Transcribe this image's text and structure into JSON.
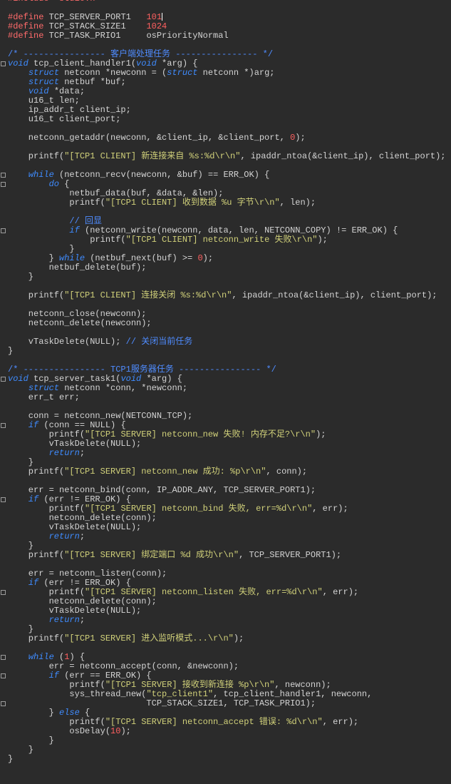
{
  "editor": {
    "language": "C",
    "theme": {
      "background": "#2b2b2b",
      "text": "#d4d4d4",
      "keyword": "#3f8cff",
      "preprocessor": "#ff6b6b",
      "string": "#d1d17a",
      "comment": "#4f8cff",
      "number": "#ff6060"
    },
    "lines": [
      [
        [
          "pp",
          "#include <stdio.h>"
        ]
      ],
      [],
      [
        [
          "pp",
          "#define"
        ],
        [
          "t",
          " TCP_SERVER_PORT1   "
        ],
        [
          "num",
          "101"
        ],
        [
          "caret",
          ""
        ]
      ],
      [
        [
          "pp",
          "#define"
        ],
        [
          "t",
          " TCP_STACK_SIZE1    "
        ],
        [
          "num",
          "1024"
        ]
      ],
      [
        [
          "pp",
          "#define"
        ],
        [
          "t",
          " TCP_TASK_PRIO1     osPriorityNormal"
        ]
      ],
      [],
      [
        [
          "cm",
          "/* ---------------- 客户端处理任务 ---------------- */"
        ]
      ],
      [
        [
          "kw",
          "void"
        ],
        [
          "t",
          " tcp_client_handler1("
        ],
        [
          "kw",
          "void"
        ],
        [
          "t",
          " *arg) {"
        ]
      ],
      [
        [
          "t",
          "    "
        ],
        [
          "kw",
          "struct"
        ],
        [
          "t",
          " netconn *newconn = ("
        ],
        [
          "kw",
          "struct"
        ],
        [
          "t",
          " netconn *)arg;"
        ]
      ],
      [
        [
          "t",
          "    "
        ],
        [
          "kw",
          "struct"
        ],
        [
          "t",
          " netbuf *buf;"
        ]
      ],
      [
        [
          "t",
          "    "
        ],
        [
          "kw",
          "void"
        ],
        [
          "t",
          " *data;"
        ]
      ],
      [
        [
          "t",
          "    u16_t len;"
        ]
      ],
      [
        [
          "t",
          "    ip_addr_t client_ip;"
        ]
      ],
      [
        [
          "t",
          "    u16_t client_port;"
        ]
      ],
      [],
      [
        [
          "t",
          "    netconn_getaddr(newconn, &client_ip, &client_port, "
        ],
        [
          "num",
          "0"
        ],
        [
          "t",
          ");"
        ]
      ],
      [],
      [
        [
          "t",
          "    printf("
        ],
        [
          "str",
          "\"[TCP1 CLIENT] 新连接来自 %s:%d\\r\\n\""
        ],
        [
          "t",
          ", ipaddr_ntoa(&client_ip), client_port);"
        ]
      ],
      [],
      [
        [
          "t",
          "    "
        ],
        [
          "kw",
          "while"
        ],
        [
          "t",
          " (netconn_recv(newconn, &buf) == ERR_OK) {"
        ]
      ],
      [
        [
          "t",
          "        "
        ],
        [
          "kw",
          "do"
        ],
        [
          "t",
          " {"
        ]
      ],
      [
        [
          "t",
          "            netbuf_data(buf, &data, &len);"
        ]
      ],
      [
        [
          "t",
          "            printf("
        ],
        [
          "str",
          "\"[TCP1 CLIENT] 收到数据 %u 字节\\r\\n\""
        ],
        [
          "t",
          ", len);"
        ]
      ],
      [],
      [
        [
          "t",
          "            "
        ],
        [
          "cm",
          "// 回显"
        ]
      ],
      [
        [
          "t",
          "            "
        ],
        [
          "kw",
          "if"
        ],
        [
          "t",
          " (netconn_write(newconn, data, len, NETCONN_COPY) != ERR_OK) {"
        ]
      ],
      [
        [
          "t",
          "                printf("
        ],
        [
          "str",
          "\"[TCP1 CLIENT] netconn_write 失败\\r\\n\""
        ],
        [
          "t",
          ");"
        ]
      ],
      [
        [
          "t",
          "            }"
        ]
      ],
      [
        [
          "t",
          "        } "
        ],
        [
          "kw",
          "while"
        ],
        [
          "t",
          " (netbuf_next(buf) >= "
        ],
        [
          "num",
          "0"
        ],
        [
          "t",
          ");"
        ]
      ],
      [
        [
          "t",
          "        netbuf_delete(buf);"
        ]
      ],
      [
        [
          "t",
          "    }"
        ]
      ],
      [],
      [
        [
          "t",
          "    printf("
        ],
        [
          "str",
          "\"[TCP1 CLIENT] 连接关闭 %s:%d\\r\\n\""
        ],
        [
          "t",
          ", ipaddr_ntoa(&client_ip), client_port);"
        ]
      ],
      [],
      [
        [
          "t",
          "    netconn_close(newconn);"
        ]
      ],
      [
        [
          "t",
          "    netconn_delete(newconn);"
        ]
      ],
      [],
      [
        [
          "t",
          "    vTaskDelete(NULL); "
        ],
        [
          "cm",
          "// 关闭当前任务"
        ]
      ],
      [
        [
          "t",
          "}"
        ]
      ],
      [],
      [
        [
          "cm",
          "/* ---------------- TCP1服务器任务 ---------------- */"
        ]
      ],
      [
        [
          "kw",
          "void"
        ],
        [
          "t",
          " tcp_server_task1("
        ],
        [
          "kw",
          "void"
        ],
        [
          "t",
          " *arg) {"
        ]
      ],
      [
        [
          "t",
          "    "
        ],
        [
          "kw",
          "struct"
        ],
        [
          "t",
          " netconn *conn, *newconn;"
        ]
      ],
      [
        [
          "t",
          "    err_t err;"
        ]
      ],
      [],
      [
        [
          "t",
          "    conn = netconn_new(NETCONN_TCP);"
        ]
      ],
      [
        [
          "t",
          "    "
        ],
        [
          "kw",
          "if"
        ],
        [
          "t",
          " (conn == NULL) {"
        ]
      ],
      [
        [
          "t",
          "        printf("
        ],
        [
          "str",
          "\"[TCP1 SERVER] netconn_new 失败! 内存不足?\\r\\n\""
        ],
        [
          "t",
          ");"
        ]
      ],
      [
        [
          "t",
          "        vTaskDelete(NULL);"
        ]
      ],
      [
        [
          "t",
          "        "
        ],
        [
          "kw",
          "return"
        ],
        [
          "t",
          ";"
        ]
      ],
      [
        [
          "t",
          "    }"
        ]
      ],
      [
        [
          "t",
          "    printf("
        ],
        [
          "str",
          "\"[TCP1 SERVER] netconn_new 成功: %p\\r\\n\""
        ],
        [
          "t",
          ", conn);"
        ]
      ],
      [],
      [
        [
          "t",
          "    err = netconn_bind(conn, IP_ADDR_ANY, TCP_SERVER_PORT1);"
        ]
      ],
      [
        [
          "t",
          "    "
        ],
        [
          "kw",
          "if"
        ],
        [
          "t",
          " (err != ERR_OK) {"
        ]
      ],
      [
        [
          "t",
          "        printf("
        ],
        [
          "str",
          "\"[TCP1 SERVER] netconn_bind 失败, err=%d\\r\\n\""
        ],
        [
          "t",
          ", err);"
        ]
      ],
      [
        [
          "t",
          "        netconn_delete(conn);"
        ]
      ],
      [
        [
          "t",
          "        vTaskDelete(NULL);"
        ]
      ],
      [
        [
          "t",
          "        "
        ],
        [
          "kw",
          "return"
        ],
        [
          "t",
          ";"
        ]
      ],
      [
        [
          "t",
          "    }"
        ]
      ],
      [
        [
          "t",
          "    printf("
        ],
        [
          "str",
          "\"[TCP1 SERVER] 绑定端口 %d 成功\\r\\n\""
        ],
        [
          "t",
          ", TCP_SERVER_PORT1);"
        ]
      ],
      [],
      [
        [
          "t",
          "    err = netconn_listen(conn);"
        ]
      ],
      [
        [
          "t",
          "    "
        ],
        [
          "kw",
          "if"
        ],
        [
          "t",
          " (err != ERR_OK) {"
        ]
      ],
      [
        [
          "t",
          "        printf("
        ],
        [
          "str",
          "\"[TCP1 SERVER] netconn_listen 失败, err=%d\\r\\n\""
        ],
        [
          "t",
          ", err);"
        ]
      ],
      [
        [
          "t",
          "        netconn_delete(conn);"
        ]
      ],
      [
        [
          "t",
          "        vTaskDelete(NULL);"
        ]
      ],
      [
        [
          "t",
          "        "
        ],
        [
          "kw",
          "return"
        ],
        [
          "t",
          ";"
        ]
      ],
      [
        [
          "t",
          "    }"
        ]
      ],
      [
        [
          "t",
          "    printf("
        ],
        [
          "str",
          "\"[TCP1 SERVER] 进入监听模式...\\r\\n\""
        ],
        [
          "t",
          ");"
        ]
      ],
      [],
      [
        [
          "t",
          "    "
        ],
        [
          "kw",
          "while"
        ],
        [
          "t",
          " ("
        ],
        [
          "num",
          "1"
        ],
        [
          "t",
          ") {"
        ]
      ],
      [
        [
          "t",
          "        err = netconn_accept(conn, &newconn);"
        ]
      ],
      [
        [
          "t",
          "        "
        ],
        [
          "kw",
          "if"
        ],
        [
          "t",
          " (err == ERR_OK) {"
        ]
      ],
      [
        [
          "t",
          "            printf("
        ],
        [
          "str",
          "\"[TCP1 SERVER] 接收到新连接 %p\\r\\n\""
        ],
        [
          "t",
          ", newconn);"
        ]
      ],
      [
        [
          "t",
          "            sys_thread_new("
        ],
        [
          "str",
          "\"tcp_client1\""
        ],
        [
          "t",
          ", tcp_client_handler1, newconn,"
        ]
      ],
      [
        [
          "t",
          "                           TCP_STACK_SIZE1, TCP_TASK_PRIO1);"
        ]
      ],
      [
        [
          "t",
          "        } "
        ],
        [
          "kw",
          "else"
        ],
        [
          "t",
          " {"
        ]
      ],
      [
        [
          "t",
          "            printf("
        ],
        [
          "str",
          "\"[TCP1 SERVER] netconn_accept 错误: %d\\r\\n\""
        ],
        [
          "t",
          ", err);"
        ]
      ],
      [
        [
          "t",
          "            osDelay("
        ],
        [
          "num",
          "10"
        ],
        [
          "t",
          ");"
        ]
      ],
      [
        [
          "t",
          "        }"
        ]
      ],
      [
        [
          "t",
          "    }"
        ]
      ],
      [
        [
          "t",
          "}"
        ]
      ]
    ]
  }
}
